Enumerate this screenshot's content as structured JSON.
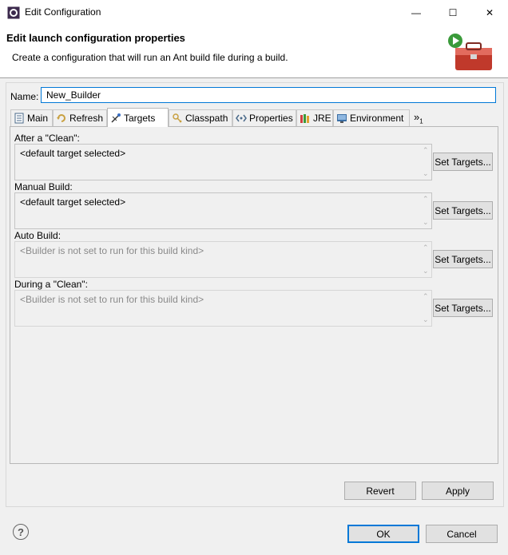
{
  "window": {
    "title": "Edit Configuration",
    "minimize": "—",
    "maximize": "☐",
    "close": "✕"
  },
  "header": {
    "title": "Edit launch configuration properties",
    "description": "Create a configuration that will run an Ant build file during a build."
  },
  "name": {
    "label": "Name:",
    "value": "New_Builder"
  },
  "tabs": [
    {
      "label": "Main"
    },
    {
      "label": "Refresh"
    },
    {
      "label": "Targets",
      "active": true
    },
    {
      "label": "Classpath"
    },
    {
      "label": "Properties"
    },
    {
      "label": "JRE"
    },
    {
      "label": "Environment"
    }
  ],
  "tab_overflow": {
    "chevron": "»",
    "count": "1"
  },
  "targets": {
    "after_clean": {
      "label": "After a \"Clean\":",
      "value": "<default target selected>",
      "button": "Set Targets..."
    },
    "manual_build": {
      "label": "Manual Build:",
      "value": "<default target selected>",
      "button": "Set Targets..."
    },
    "auto_build": {
      "label": "Auto Build:",
      "value": "<Builder is not set to run for this build kind>",
      "button": "Set Targets..."
    },
    "during_clean": {
      "label": "During a \"Clean\":",
      "value": "<Builder is not set to run for this build kind>",
      "button": "Set Targets..."
    }
  },
  "buttons": {
    "revert": "Revert",
    "apply": "Apply",
    "ok": "OK",
    "cancel": "Cancel",
    "help": "?"
  },
  "colors": {
    "focus_border": "#0078d7",
    "background": "#f0f0f0"
  }
}
